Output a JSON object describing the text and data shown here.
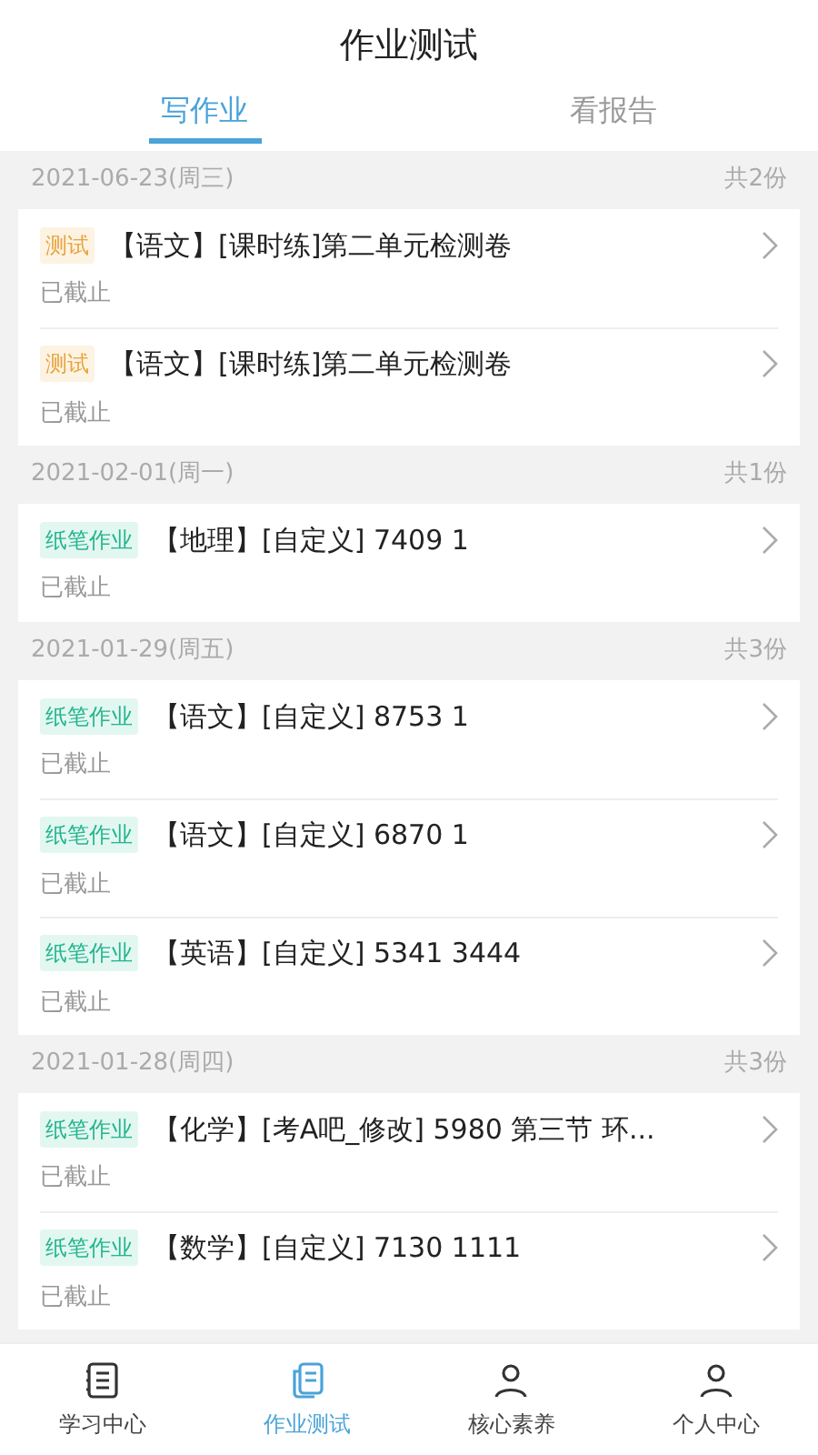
{
  "header": {
    "title": "作业测试"
  },
  "tabs": [
    {
      "label": "写作业",
      "selected": true
    },
    {
      "label": "看报告",
      "selected": false
    }
  ],
  "groups": [
    {
      "date": "2021-06-23(周三)",
      "count": "共2份",
      "items": [
        {
          "tag": "测试",
          "kind": "test",
          "title": "【语文】[课时练]第二单元检测卷",
          "status": "已截止"
        },
        {
          "tag": "测试",
          "kind": "test",
          "title": "【语文】[课时练]第二单元检测卷",
          "status": "已截止"
        }
      ]
    },
    {
      "date": "2021-02-01(周一)",
      "count": "共1份",
      "items": [
        {
          "tag": "纸笔作业",
          "kind": "paper",
          "title": "【地理】[自定义] 7409 1",
          "status": "已截止"
        }
      ]
    },
    {
      "date": "2021-01-29(周五)",
      "count": "共3份",
      "items": [
        {
          "tag": "纸笔作业",
          "kind": "paper",
          "title": "【语文】[自定义] 8753 1",
          "status": "已截止"
        },
        {
          "tag": "纸笔作业",
          "kind": "paper",
          "title": "【语文】[自定义] 6870 1",
          "status": "已截止"
        },
        {
          "tag": "纸笔作业",
          "kind": "paper",
          "title": "【英语】[自定义] 5341 3444",
          "status": "已截止"
        }
      ]
    },
    {
      "date": "2021-01-28(周四)",
      "count": "共3份",
      "items": [
        {
          "tag": "纸笔作业",
          "kind": "paper",
          "title": "【化学】[考A吧_修改] 5980 第三节 环...",
          "status": "已截止"
        },
        {
          "tag": "纸笔作业",
          "kind": "paper",
          "title": "【数学】[自定义] 7130 1111",
          "status": "已截止"
        }
      ]
    }
  ],
  "bottom_nav": [
    {
      "label": "学习中心",
      "selected": false
    },
    {
      "label": "作业测试",
      "selected": true
    },
    {
      "label": "核心素养",
      "selected": false
    },
    {
      "label": "个人中心",
      "selected": false
    }
  ]
}
